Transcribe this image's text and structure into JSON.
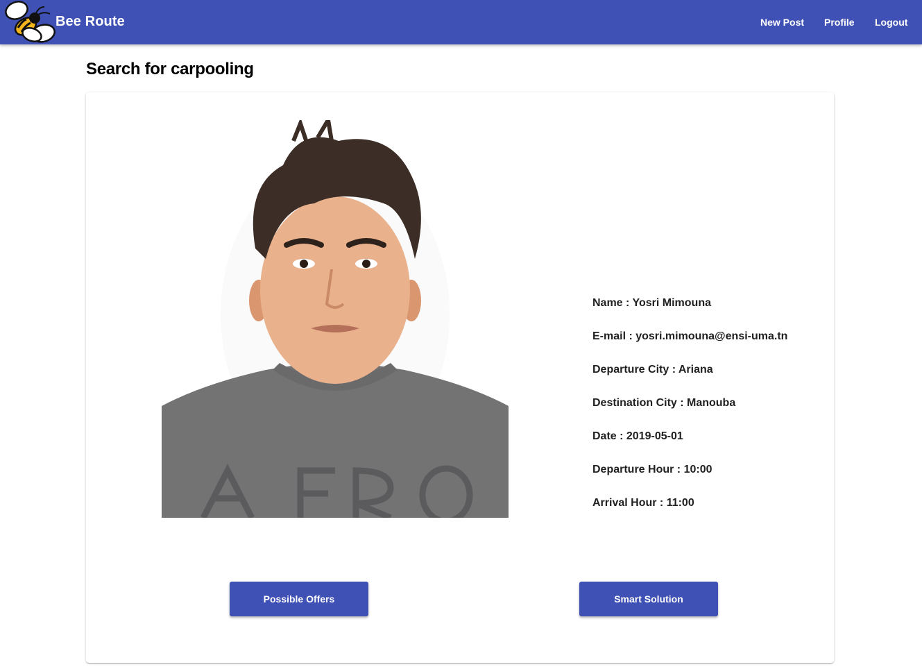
{
  "app": {
    "brand": "Bee Route"
  },
  "nav": {
    "new_post": "New Post",
    "profile": "Profile",
    "logout": "Logout"
  },
  "page": {
    "title": "Search for carpooling"
  },
  "profile_card": {
    "shirt_text": "AFRO",
    "name": "Name : Yosri Mimouna",
    "email": "E-mail : yosri.mimouna@ensi-uma.tn",
    "departure_city": "Departure City : Ariana",
    "destination_city": "Destination City : Manouba",
    "date": "Date : 2019-05-01",
    "departure_hour": "Departure Hour : 10:00",
    "arrival_hour": "Arrival Hour : 11:00"
  },
  "actions": {
    "possible_offers": "Possible Offers",
    "smart_solution": "Smart Solution"
  },
  "colors": {
    "primary": "#3f51b5",
    "text": "#212121",
    "background": "#ffffff"
  }
}
